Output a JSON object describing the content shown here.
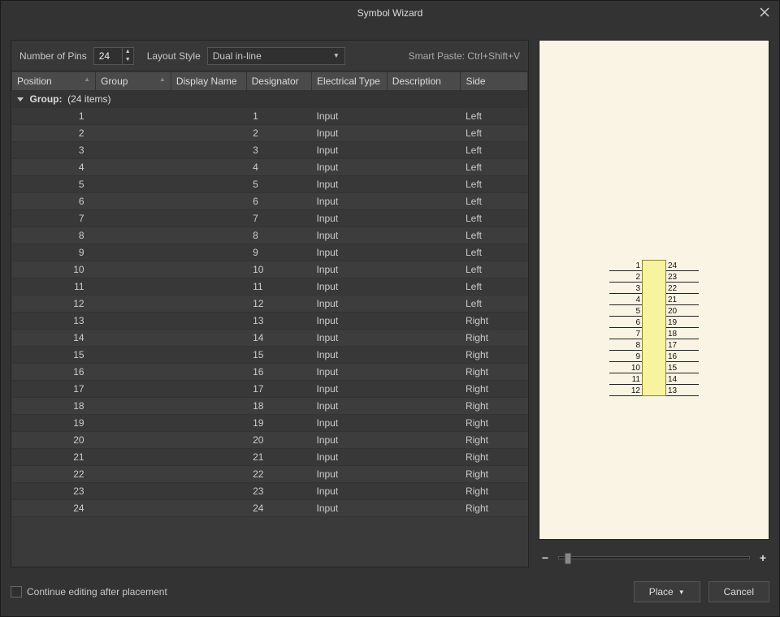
{
  "window_title": "Symbol Wizard",
  "controls": {
    "num_pins_label": "Number of Pins",
    "num_pins_value": "24",
    "layout_label": "Layout Style",
    "layout_value": "Dual in-line",
    "smart_paste": "Smart Paste: Ctrl+Shift+V"
  },
  "columns": {
    "position": "Position",
    "group": "Group",
    "display_name": "Display Name",
    "designator": "Designator",
    "electrical": "Electrical Type",
    "description": "Description",
    "side": "Side"
  },
  "group_row": {
    "label": "Group:",
    "count": "(24 items)"
  },
  "rows": [
    {
      "position": "1",
      "designator": "1",
      "electrical": "Input",
      "side": "Left"
    },
    {
      "position": "2",
      "designator": "2",
      "electrical": "Input",
      "side": "Left"
    },
    {
      "position": "3",
      "designator": "3",
      "electrical": "Input",
      "side": "Left"
    },
    {
      "position": "4",
      "designator": "4",
      "electrical": "Input",
      "side": "Left"
    },
    {
      "position": "5",
      "designator": "5",
      "electrical": "Input",
      "side": "Left"
    },
    {
      "position": "6",
      "designator": "6",
      "electrical": "Input",
      "side": "Left"
    },
    {
      "position": "7",
      "designator": "7",
      "electrical": "Input",
      "side": "Left"
    },
    {
      "position": "8",
      "designator": "8",
      "electrical": "Input",
      "side": "Left"
    },
    {
      "position": "9",
      "designator": "9",
      "electrical": "Input",
      "side": "Left"
    },
    {
      "position": "10",
      "designator": "10",
      "electrical": "Input",
      "side": "Left"
    },
    {
      "position": "11",
      "designator": "11",
      "electrical": "Input",
      "side": "Left"
    },
    {
      "position": "12",
      "designator": "12",
      "electrical": "Input",
      "side": "Left"
    },
    {
      "position": "13",
      "designator": "13",
      "electrical": "Input",
      "side": "Right"
    },
    {
      "position": "14",
      "designator": "14",
      "electrical": "Input",
      "side": "Right"
    },
    {
      "position": "15",
      "designator": "15",
      "electrical": "Input",
      "side": "Right"
    },
    {
      "position": "16",
      "designator": "16",
      "electrical": "Input",
      "side": "Right"
    },
    {
      "position": "17",
      "designator": "17",
      "electrical": "Input",
      "side": "Right"
    },
    {
      "position": "18",
      "designator": "18",
      "electrical": "Input",
      "side": "Right"
    },
    {
      "position": "19",
      "designator": "19",
      "electrical": "Input",
      "side": "Right"
    },
    {
      "position": "20",
      "designator": "20",
      "electrical": "Input",
      "side": "Right"
    },
    {
      "position": "21",
      "designator": "21",
      "electrical": "Input",
      "side": "Right"
    },
    {
      "position": "22",
      "designator": "22",
      "electrical": "Input",
      "side": "Right"
    },
    {
      "position": "23",
      "designator": "23",
      "electrical": "Input",
      "side": "Right"
    },
    {
      "position": "24",
      "designator": "24",
      "electrical": "Input",
      "side": "Right"
    }
  ],
  "preview": {
    "left_pins": [
      "1",
      "2",
      "3",
      "4",
      "5",
      "6",
      "7",
      "8",
      "9",
      "10",
      "11",
      "12"
    ],
    "right_pins": [
      "24",
      "23",
      "22",
      "21",
      "20",
      "19",
      "18",
      "17",
      "16",
      "15",
      "14",
      "13"
    ]
  },
  "zoom": {
    "minus": "−",
    "plus": "+"
  },
  "footer": {
    "checkbox_label": "Continue editing after placement",
    "place": "Place",
    "cancel": "Cancel"
  }
}
